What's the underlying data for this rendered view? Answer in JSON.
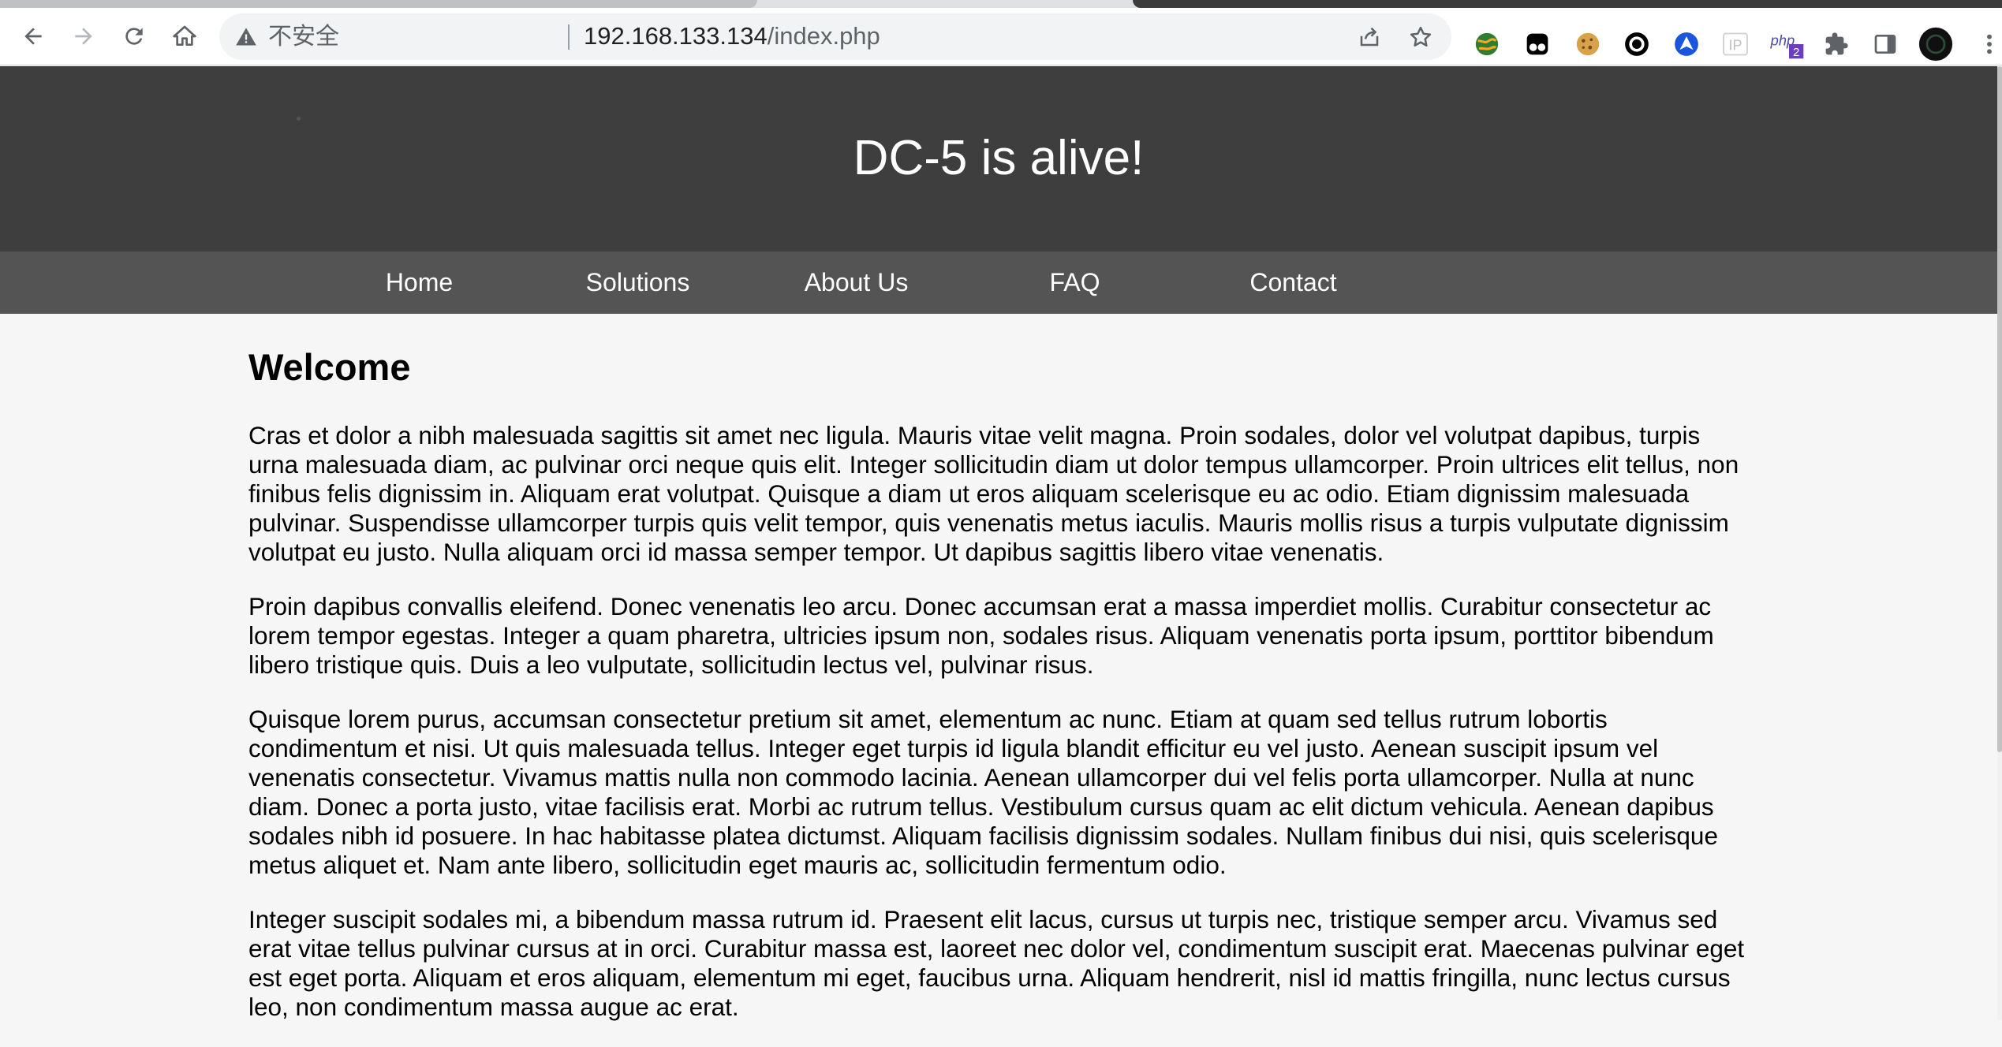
{
  "browser": {
    "security_label": "不安全",
    "url_host": "192.168.133.134",
    "url_path": "/index.php",
    "extension_badge": "2",
    "extension_php_label": "php",
    "extension_ip_label": "IP",
    "icons": [
      "back-icon",
      "forward-icon",
      "reload-icon",
      "home-icon",
      "warning-icon",
      "share-icon",
      "star-icon",
      "extensions-puzzle-icon",
      "side-panel-icon",
      "profile-avatar"
    ]
  },
  "site": {
    "title": "DC-5 is alive!",
    "nav": [
      {
        "label": "Home"
      },
      {
        "label": "Solutions"
      },
      {
        "label": "About Us"
      },
      {
        "label": "FAQ"
      },
      {
        "label": "Contact"
      }
    ]
  },
  "main": {
    "heading": "Welcome",
    "paragraphs": [
      "Cras et dolor a nibh malesuada sagittis sit amet nec ligula. Mauris vitae velit magna. Proin sodales, dolor vel volutpat dapibus, turpis urna malesuada diam, ac pulvinar orci neque quis elit. Integer sollicitudin diam ut dolor tempus ullamcorper. Proin ultrices elit tellus, non finibus felis dignissim in. Aliquam erat volutpat. Quisque a diam ut eros aliquam scelerisque eu ac odio. Etiam dignissim malesuada pulvinar. Suspendisse ullamcorper turpis quis velit tempor, quis venenatis metus iaculis. Mauris mollis risus a turpis vulputate dignissim volutpat eu justo. Nulla aliquam orci id massa semper tempor. Ut dapibus sagittis libero vitae venenatis.",
      "Proin dapibus convallis eleifend. Donec venenatis leo arcu. Donec accumsan erat a massa imperdiet mollis. Curabitur consectetur ac lorem tempor egestas. Integer a quam pharetra, ultricies ipsum non, sodales risus. Aliquam venenatis porta ipsum, porttitor bibendum libero tristique quis. Duis a leo vulputate, sollicitudin lectus vel, pulvinar risus.",
      "Quisque lorem purus, accumsan consectetur pretium sit amet, elementum ac nunc. Etiam at quam sed tellus rutrum lobortis condimentum et nisi. Ut quis malesuada tellus. Integer eget turpis id ligula blandit efficitur eu vel justo. Aenean suscipit ipsum vel venenatis consectetur. Vivamus mattis nulla non commodo lacinia. Aenean ullamcorper dui vel felis porta ullamcorper. Nulla at nunc diam. Donec a porta justo, vitae facilisis erat. Morbi ac rutrum tellus. Vestibulum cursus quam ac elit dictum vehicula. Aenean dapibus sodales nibh id posuere. In hac habitasse platea dictumst. Aliquam facilisis dignissim sodales. Nullam finibus dui nisi, quis scelerisque metus aliquet et. Nam ante libero, sollicitudin eget mauris ac, sollicitudin fermentum odio.",
      "Integer suscipit sodales mi, a bibendum massa rutrum id. Praesent elit lacus, cursus ut turpis nec, tristique semper arcu. Vivamus sed erat vitae tellus pulvinar cursus at in orci. Curabitur massa est, laoreet nec dolor vel, condimentum suscipit erat. Maecenas pulvinar eget est eget porta. Aliquam et eros aliquam, elementum mi eget, faucibus urna. Aliquam hendrerit, nisl id mattis fringilla, nunc lectus cursus leo, non condimentum massa augue ac erat."
    ]
  },
  "colors": {
    "header_bg": "#3e3e3e",
    "nav_bg": "#545454",
    "page_bg": "#f6f6f6"
  }
}
